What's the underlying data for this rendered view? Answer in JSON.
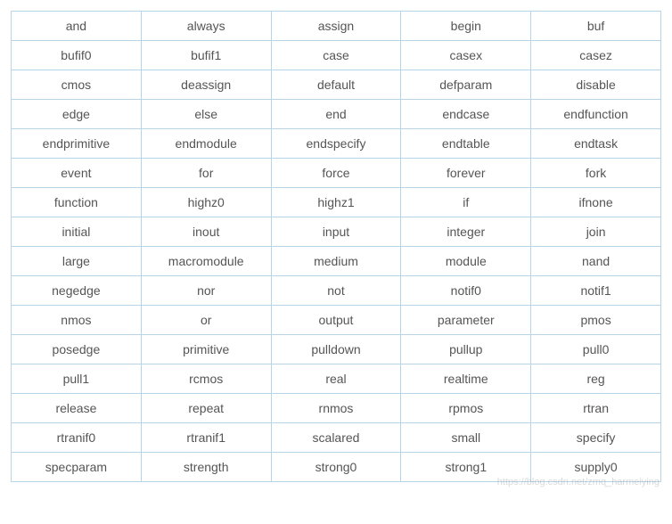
{
  "table": {
    "rows": [
      [
        "and",
        "always",
        "assign",
        "begin",
        "buf"
      ],
      [
        "bufif0",
        "bufif1",
        "case",
        "casex",
        "casez"
      ],
      [
        "cmos",
        "deassign",
        "default",
        "defparam",
        "disable"
      ],
      [
        "edge",
        "else",
        "end",
        "endcase",
        "endfunction"
      ],
      [
        "endprimitive",
        "endmodule",
        "endspecify",
        "endtable",
        "endtask"
      ],
      [
        "event",
        "for",
        "force",
        "forever",
        "fork"
      ],
      [
        "function",
        "highz0",
        "highz1",
        "if",
        "ifnone"
      ],
      [
        "initial",
        "inout",
        "input",
        "integer",
        "join"
      ],
      [
        "large",
        "macromodule",
        "medium",
        "module",
        "nand"
      ],
      [
        "negedge",
        "nor",
        "not",
        "notif0",
        "notif1"
      ],
      [
        "nmos",
        "or",
        "output",
        "parameter",
        "pmos"
      ],
      [
        "posedge",
        "primitive",
        "pulldown",
        "pullup",
        "pull0"
      ],
      [
        "pull1",
        "rcmos",
        "real",
        "realtime",
        "reg"
      ],
      [
        "release",
        "repeat",
        "rnmos",
        "rpmos",
        "rtran"
      ],
      [
        "rtranif0",
        "rtranif1",
        "scalared",
        "small",
        "specify"
      ],
      [
        "specparam",
        "strength",
        "strong0",
        "strong1",
        "supply0"
      ]
    ]
  },
  "watermark": "https://blog.csdn.net/zmq_harmeiying"
}
